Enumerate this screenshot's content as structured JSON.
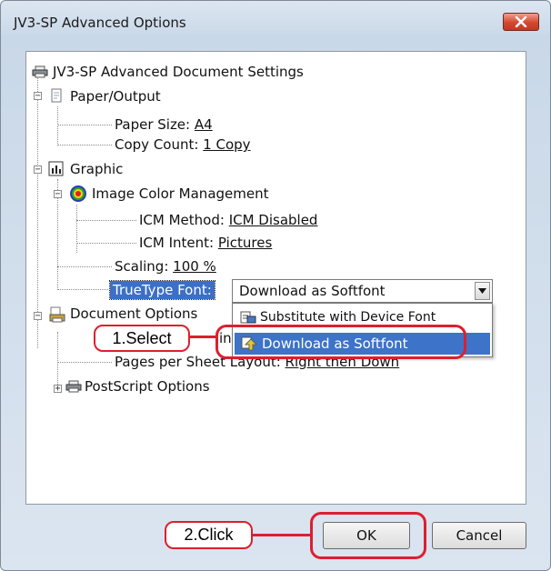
{
  "window": {
    "title": "JV3-SP Advanced Options",
    "close_icon": "close-x-icon"
  },
  "tree": {
    "root": {
      "label": "JV3-SP Advanced Document Settings",
      "icon": "printer-icon"
    },
    "paper_output": {
      "label": "Paper/Output",
      "icon": "paper-output-icon",
      "paper_size": {
        "label": "Paper Size: ",
        "value": "A4"
      },
      "copy_count": {
        "label": "Copy Count: ",
        "value": "1 Copy"
      }
    },
    "graphic": {
      "label": "Graphic",
      "icon": "graphic-chart-icon",
      "icm": {
        "label": "Image Color Management",
        "icon": "color-wheel-icon",
        "method": {
          "label": "ICM Method: ",
          "value": "ICM Disabled"
        },
        "intent": {
          "label": "ICM Intent: ",
          "value": "Pictures"
        }
      },
      "scaling": {
        "label": "Scaling: ",
        "value": "100 %"
      },
      "truetype_font": {
        "label": "TrueType Font:",
        "selected": "Download as Softfont",
        "options": [
          "Substitute with Device Font",
          "Download as Softfont"
        ]
      }
    },
    "document_options": {
      "label": "Document Options",
      "icon": "document-options-icon",
      "advanced_printing_partial": "in",
      "pages_per_sheet": {
        "label": "Pages per Sheet Layout: ",
        "value": "Right then Down"
      },
      "postscript": {
        "label": "PostScript Options",
        "icon": "printer-icon"
      }
    }
  },
  "callouts": {
    "select": "1.Select",
    "click": "2.Click"
  },
  "buttons": {
    "ok": "OK",
    "cancel": "Cancel"
  },
  "colors": {
    "highlight": "#3d73c8",
    "callout_red": "#dd1f2e",
    "close_red": "#d4472f"
  }
}
